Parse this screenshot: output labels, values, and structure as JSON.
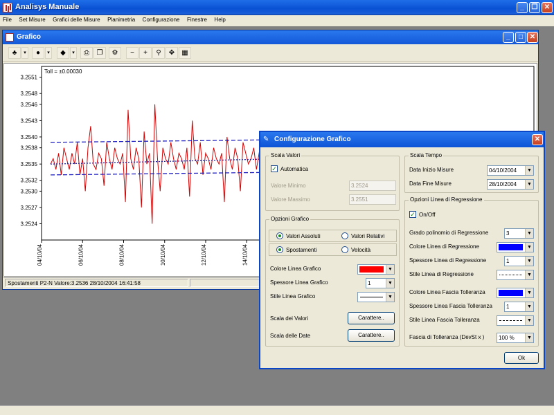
{
  "app": {
    "title": "Analisys Manuale",
    "menu": [
      "File",
      "Set Misure",
      "Grafici delle Misure",
      "Planimetria",
      "Configurazione",
      "Finestre",
      "Help"
    ]
  },
  "grafico_window": {
    "title": "Grafico",
    "toll_label": "Toll = ±0.00030",
    "status": {
      "left": "Spostamenti P2-N  Valore:3.2536  28/10/2004 16:41:58"
    }
  },
  "chart_data": {
    "type": "line",
    "y_ticks": [
      "3.2551",
      "3.2548",
      "3.2546",
      "3.2543",
      "3.2540",
      "3.2538",
      "3.2535",
      "3.2532",
      "3.2530",
      "3.2527",
      "3.2524"
    ],
    "x_ticks": [
      "04/10/04",
      "06/10/04",
      "08/10/04",
      "10/10/04",
      "12/10/04",
      "14/10/04"
    ],
    "ylim": [
      3.2521,
      3.2553
    ],
    "x_start": "04/10/2004",
    "x_end": "28/10/2004",
    "series": [
      {
        "color": "#d40000",
        "style": "solid",
        "values": [
          3.2535,
          3.2536,
          3.2534,
          3.2537,
          3.2533,
          3.2538,
          3.2536,
          3.2534,
          3.2537,
          3.2535,
          3.2539,
          3.2533,
          3.2536,
          3.253,
          3.2538,
          3.2542,
          3.2535,
          3.2534,
          3.2537,
          3.2536,
          3.2531,
          3.2539,
          3.2536,
          3.2534,
          3.2538,
          3.2536,
          3.2535,
          3.2537,
          3.2528,
          3.2545,
          3.2536,
          3.2534,
          3.2538,
          3.2536,
          3.2527,
          3.2541,
          3.2535,
          3.2537,
          3.2524,
          3.2546,
          3.2536,
          3.253,
          3.2538,
          3.2536,
          3.2535,
          3.2539,
          3.2536,
          3.2534,
          3.2537,
          3.2536,
          3.2534,
          3.2538,
          3.2529,
          3.2543,
          3.2536,
          3.2535,
          3.2539,
          3.2533,
          3.2537,
          3.2536,
          3.2534,
          3.2538,
          3.2536,
          3.2535,
          3.2537,
          3.2528,
          3.254,
          3.2536,
          3.2534,
          3.2538,
          3.2536,
          3.253,
          3.2539,
          3.2537,
          3.2535,
          3.2536,
          3.2538,
          3.2534,
          3.2537,
          3.2536
        ]
      },
      {
        "name": "",
        "color": "#2020c0",
        "style": "dashed",
        "values": [
          3.2539,
          3.254
        ]
      },
      {
        "name": "",
        "color": "#2020c0",
        "style": "dashed",
        "values": [
          3.2533,
          3.2534
        ]
      },
      {
        "name": "",
        "color": "#2020c0",
        "style": "dotted",
        "values": [
          3.2535,
          3.2537
        ]
      }
    ]
  },
  "dialog": {
    "title": "Configurazione Grafico",
    "scala_valori": {
      "title": "Scala Valori",
      "automatica": "Automatica",
      "automatica_checked": true,
      "valore_minimo_label": "Valore Minimo",
      "valore_minimo": "3.2524",
      "valore_massimo_label": "Valore Massimo",
      "valore_massimo": "3.2551"
    },
    "opzioni_grafico": {
      "title": "Opzioni Grafico",
      "valori_assoluti": "Valori Assoluti",
      "valori_relativi": "Valori Relativi",
      "spostamenti": "Spostamenti",
      "velocita": "Velocità",
      "colore_linea_label": "Colore Linea Grafico",
      "colore_linea": "#ff0000",
      "spessore_linea_label": "Spessore Linea Grafico",
      "spessore_linea": "1",
      "stile_linea_label": "Stile Linea Grafico",
      "scala_valori_label": "Scala dei Valori",
      "scala_date_label": "Scala delle Date",
      "caratteri_btn": "Carattere.."
    },
    "scala_tempo": {
      "title": "Scala Tempo",
      "data_inizio_label": "Data Inizio Misure",
      "data_inizio": "04/10/2004",
      "data_fine_label": "Data Fine Misure",
      "data_fine": "28/10/2004"
    },
    "regressione": {
      "title": "Opzioni Linea di Regressione",
      "onoff": "On/Off",
      "onoff_checked": true,
      "grado_label": "Grado polinomio di Regressione",
      "grado": "3",
      "colore_label": "Colore Linea di Regressione",
      "colore": "#0000ff",
      "spessore_label": "Spessore Linea di Regressione",
      "spessore": "1",
      "stile_label": "Stile Linea di Regressione",
      "colore_fascia_label": "Colore Linea Fascia Tolleranza",
      "colore_fascia": "#0000ff",
      "spessore_fascia_label": "Spessore Linea Fascia Tolleranza",
      "spessore_fascia": "1",
      "stile_fascia_label": "Stile Linea Fascia Tolleranza",
      "fascia_label": "Fascia di Tolleranza (DevSt x )",
      "fascia": "100 %"
    },
    "ok_label": "Ok"
  }
}
